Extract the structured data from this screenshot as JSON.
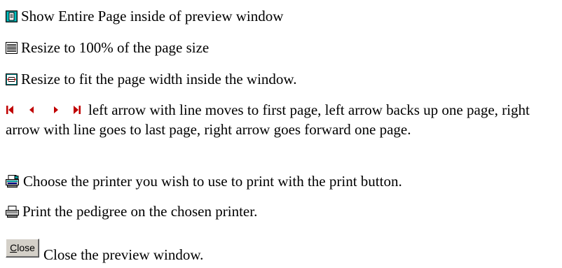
{
  "items": {
    "entire_page": {
      "icon": "whole-page-icon",
      "text": "Show Entire Page inside of preview window"
    },
    "full_size": {
      "icon": "page-100-icon",
      "text": "Resize to 100% of the page size"
    },
    "page_width": {
      "icon": "page-width-icon",
      "text": "Resize to fit the page width inside the window."
    },
    "navigation": {
      "icons": [
        "first-page-icon",
        "prior-page-icon",
        "next-page-icon",
        "last-page-icon"
      ],
      "text": "left arrow with line  moves to first page, left arrow backs up one page, right arrow with line goes to last page, right arrow goes forward one page."
    },
    "printer_setup": {
      "icon": "printer-setup-icon",
      "text": "Choose the printer you wish to use to print with the print button."
    },
    "print": {
      "icon": "printer-icon",
      "text": "Print the pedigree on the chosen printer."
    },
    "close": {
      "button_label_underlined": "C",
      "button_label_rest": "lose",
      "text": "Close the preview window."
    }
  },
  "colors": {
    "nav_arrow": "#c00000",
    "icon_blue": "#000080",
    "icon_cyan": "#00a0a0",
    "button_face": "#d4d0c8"
  }
}
